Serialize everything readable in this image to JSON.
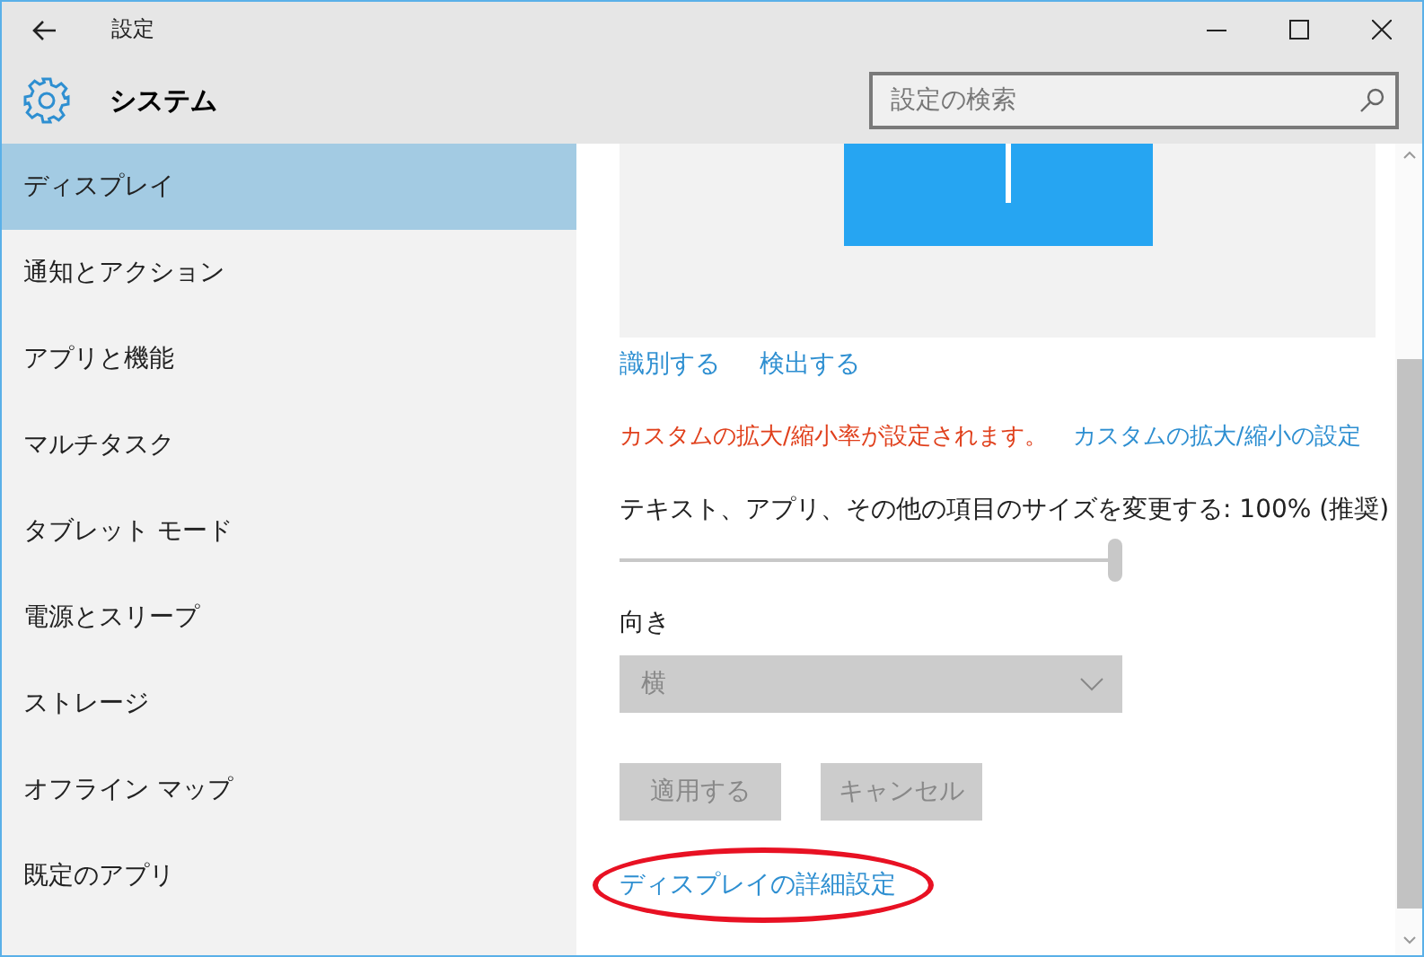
{
  "window": {
    "title": "設定"
  },
  "header": {
    "title": "システム",
    "search": {
      "placeholder": "設定の検索"
    }
  },
  "sidebar": {
    "items": [
      {
        "label": "ディスプレイ",
        "selected": true
      },
      {
        "label": "通知とアクション",
        "selected": false
      },
      {
        "label": "アプリと機能",
        "selected": false
      },
      {
        "label": "マルチタスク",
        "selected": false
      },
      {
        "label": "タブレット モード",
        "selected": false
      },
      {
        "label": "電源とスリープ",
        "selected": false
      },
      {
        "label": "ストレージ",
        "selected": false
      },
      {
        "label": "オフライン マップ",
        "selected": false
      },
      {
        "label": "既定のアプリ",
        "selected": false
      }
    ]
  },
  "display": {
    "actions": [
      "識別する",
      "検出する"
    ],
    "notice": "カスタムの拡大/縮小率が設定されます。",
    "notice_link": "カスタムの拡大/縮小の設定",
    "scale": {
      "label": "テキスト、アプリ、その他の項目のサイズを変更する: 100% (推奨)",
      "level": 1
    },
    "orientation": {
      "label": "向き",
      "value": "横",
      "disabled": true
    },
    "buttons": [
      {
        "label": "適用する",
        "disabled": true
      },
      {
        "label": "キャンセル",
        "disabled": true
      }
    ],
    "advanced_link": {
      "label": "ディスプレイの詳細設定",
      "highlighted": true
    }
  }
}
